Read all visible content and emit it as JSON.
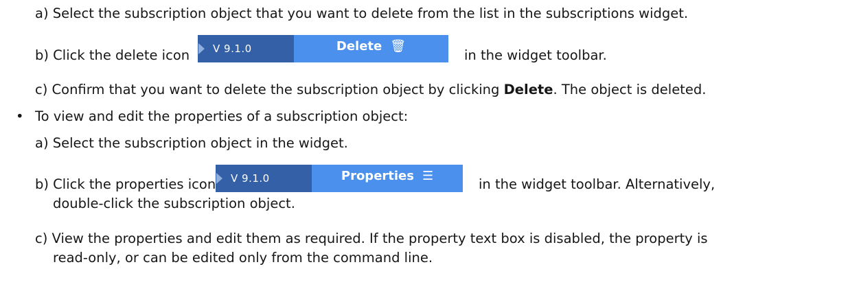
{
  "steps": {
    "delete_a": "a) Select the subscription object that you want to delete from the list in the subscriptions widget.",
    "delete_b_pre": "b) Click the delete icon",
    "delete_b_post": "in the widget toolbar.",
    "delete_c_pre": "c) Confirm that you want to delete the subscription object by clicking ",
    "delete_c_bold": "Delete",
    "delete_c_post": ". The object is deleted.",
    "bullet_view": "To view and edit the properties of a subscription object:",
    "bullet_char": "•",
    "props_a": "a) Select the subscription object in the widget.",
    "props_b_pre": "b) Click the properties icon",
    "props_b_post": "in the widget toolbar. Alternatively,",
    "props_b_cont": "double-click the subscription object.",
    "props_c_1": "c) View the properties and edit them as required. If the property text box is disabled, the property is",
    "props_c_2": "read-only, or can be edited only from the command line."
  },
  "delete_icon": {
    "version": "V 9.1.0",
    "label": "Delete",
    "glyph": "trash-icon",
    "glyph_char": "🗑"
  },
  "properties_icon": {
    "version": "V 9.1.0",
    "label": "Properties",
    "glyph": "menu-icon",
    "glyph_char": "☰"
  }
}
